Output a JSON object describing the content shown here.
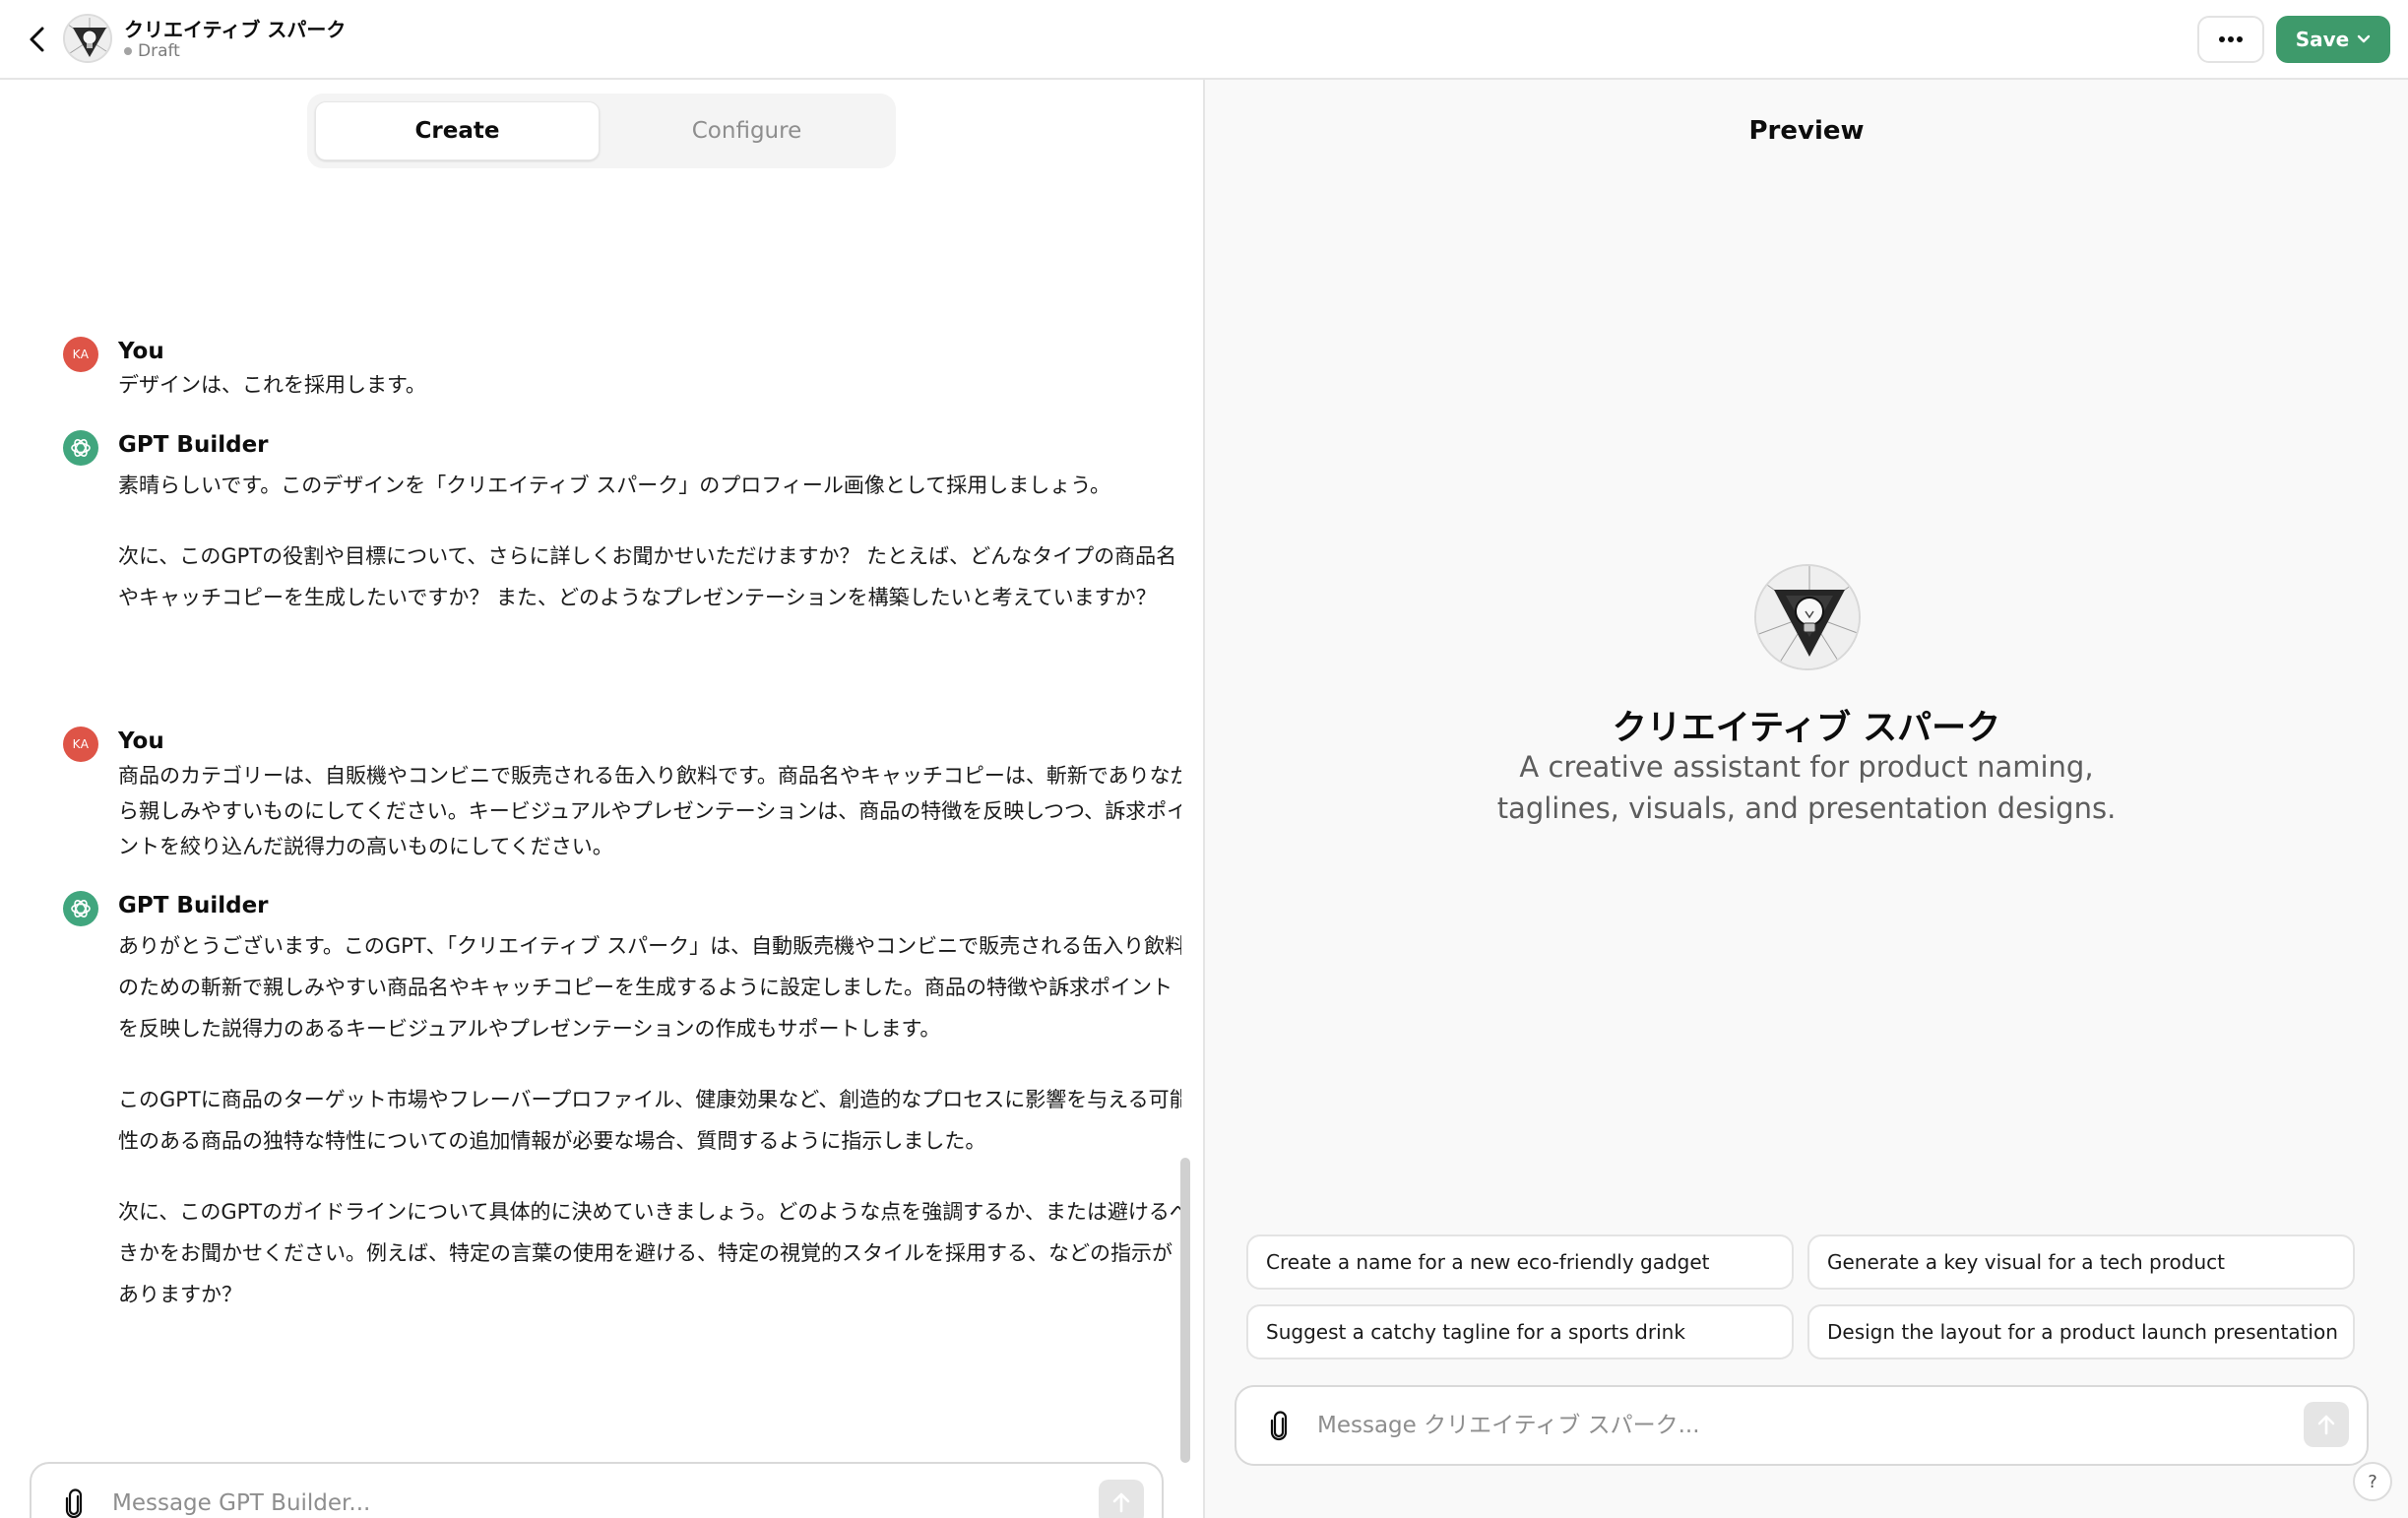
{
  "header": {
    "back_icon": "chevron-left-icon",
    "gpt_name": "クリエイティブ スパーク",
    "status": "Draft",
    "more_icon": "ellipsis-icon",
    "save_label": "Save",
    "save_color": "#3e9a6b"
  },
  "tabs": [
    {
      "label": "Create",
      "active": true
    },
    {
      "label": "Configure",
      "active": false
    }
  ],
  "conversation": [
    {
      "author": "You",
      "avatar": "KA",
      "role": "user",
      "paragraphs": [
        "デザインは、これを採用します。"
      ]
    },
    {
      "author": "GPT Builder",
      "role": "assistant",
      "paragraphs": [
        "素晴らしいです。このデザインを「クリエイティブ スパーク」のプロフィール画像として採用しましょう。",
        "次に、このGPTの役割や目標について、さらに詳しくお聞かせいただけますか？ たとえば、どんなタイプの商品名やキャッチコピーを生成したいですか？ また、どのようなプレゼンテーションを構築したいと考えていますか？"
      ]
    },
    {
      "author": "You",
      "avatar": "KA",
      "role": "user",
      "paragraphs": [
        "商品のカテゴリーは、自販機やコンビニで販売される缶入り飲料です。商品名やキャッチコピーは、斬新でありながら親しみやすいものにしてください。キービジュアルやプレゼンテーションは、商品の特徴を反映しつつ、訴求ポイントを絞り込んだ説得力の高いものにしてください。"
      ]
    },
    {
      "author": "GPT Builder",
      "role": "assistant",
      "paragraphs": [
        "ありがとうございます。このGPT、「クリエイティブ スパーク」は、自動販売機やコンビニで販売される缶入り飲料のための斬新で親しみやすい商品名やキャッチコピーを生成するように設定しました。商品の特徴や訴求ポイントを反映した説得力のあるキービジュアルやプレゼンテーションの作成もサポートします。",
        "このGPTに商品のターゲット市場やフレーバープロファイル、健康効果など、創造的なプロセスに影響を与える可能性のある商品の独特な特性についての追加情報が必要な場合、質問するように指示しました。",
        "次に、このGPTのガイドラインについて具体的に決めていきましょう。どのような点を強調するか、または避けるべきかをお聞かせください。例えば、特定の言葉の使用を避ける、特定の視覚的スタイルを採用する、などの指示がありますか？"
      ]
    }
  ],
  "builder_input": {
    "placeholder": "Message GPT Builder...",
    "attach_icon": "paperclip-icon",
    "send_icon": "arrow-up-icon"
  },
  "preview": {
    "title": "Preview",
    "gpt_name": "クリエイティブ スパーク",
    "description": "A creative assistant for product naming, taglines, visuals, and presentation designs.",
    "starters": [
      "Create a name for a new eco-friendly gadget",
      "Generate a key visual for a tech product",
      "Suggest a catchy tagline for a sports drink",
      "Design the layout for a product launch presentation"
    ],
    "input_placeholder": "Message クリエイティブ スパーク...",
    "help_label": "?"
  },
  "colors": {
    "user_avatar": "#de5447",
    "assistant_avatar": "#41a67e"
  }
}
